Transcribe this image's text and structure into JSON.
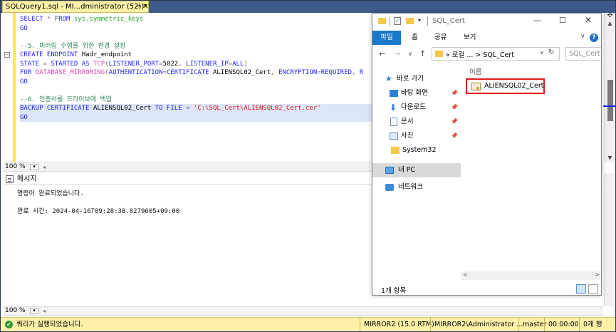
{
  "tab": {
    "title": "SQLQuery1.sql - MI...dministrator (52))*",
    "pin_glyph": "⊸",
    "close_glyph": "✕"
  },
  "code_lines": [
    {
      "segments": [
        {
          "c": "kw",
          "t": "SELECT "
        },
        {
          "c": "gray",
          "t": "* "
        },
        {
          "c": "kw",
          "t": "FROM "
        },
        {
          "c": "sys",
          "t": "sys.symmetric_keys"
        }
      ]
    },
    {
      "segments": [
        {
          "c": "kw",
          "t": "GO"
        }
      ]
    },
    {
      "segments": []
    },
    {
      "segments": [
        {
          "c": "cm",
          "t": "--5. 미러링 수행를 위한 환경 설정"
        }
      ]
    },
    {
      "segments": [
        {
          "c": "kw",
          "t": "CREATE ENDPOINT "
        },
        {
          "c": "plain",
          "t": "Hadr_endpoint"
        }
      ]
    },
    {
      "segments": [
        {
          "c": "kw",
          "t": "STATE "
        },
        {
          "c": "gray",
          "t": "= "
        },
        {
          "c": "kw",
          "t": "STARTED AS "
        },
        {
          "c": "fn",
          "t": "TCP"
        },
        {
          "c": "gray",
          "t": "("
        },
        {
          "c": "kw",
          "t": "LISTENER_PORT"
        },
        {
          "c": "gray",
          "t": "="
        },
        {
          "c": "plain",
          "t": "5022"
        },
        {
          "c": "gray",
          "t": ", "
        },
        {
          "c": "kw",
          "t": "LISTENER_IP"
        },
        {
          "c": "gray",
          "t": "="
        },
        {
          "c": "kw",
          "t": "ALL"
        },
        {
          "c": "gray",
          "t": ")"
        }
      ]
    },
    {
      "segments": [
        {
          "c": "kw",
          "t": "FOR "
        },
        {
          "c": "fn",
          "t": "DATABASE_MIRRORING"
        },
        {
          "c": "gray",
          "t": "("
        },
        {
          "c": "kw",
          "t": "AUTHENTICATION"
        },
        {
          "c": "gray",
          "t": "="
        },
        {
          "c": "kw",
          "t": "CERTIFICATE "
        },
        {
          "c": "plain",
          "t": "ALIENSQL02_Cert"
        },
        {
          "c": "gray",
          "t": ", "
        },
        {
          "c": "kw",
          "t": "ENCRYPTION"
        },
        {
          "c": "gray",
          "t": "="
        },
        {
          "c": "kw",
          "t": "REQUIRED"
        },
        {
          "c": "gray",
          "t": ", "
        },
        {
          "c": "kw",
          "t": "R"
        }
      ]
    },
    {
      "segments": [
        {
          "c": "kw",
          "t": "GO"
        }
      ]
    },
    {
      "segments": []
    },
    {
      "segments": [
        {
          "c": "cm",
          "t": "--6. 인증서를 드라이브에 백업"
        }
      ]
    },
    {
      "segments": [
        {
          "c": "kw",
          "t": "BACKUP CERTIFICATE "
        },
        {
          "c": "plain",
          "t": "ALIENSQL02_Cert "
        },
        {
          "c": "kw",
          "t": "TO FILE "
        },
        {
          "c": "gray",
          "t": "= "
        },
        {
          "c": "str",
          "t": "'C:\\SQL_Cert\\ALIENSQL02_Cert.cer'"
        }
      ]
    },
    {
      "segments": [
        {
          "c": "kw",
          "t": "GO"
        }
      ]
    }
  ],
  "collapse_glyph": "−",
  "editor_zoom": "100 %",
  "results_zoom": "100 %",
  "dropdown_glyph": "▾",
  "hscroll_left_glyph": "◂",
  "messages_tab_label": "메시지",
  "messages": {
    "line1": "명령이 완료되었습니다.",
    "line2": "완료 시간: 2024-04-16T09:28:38.8279605+09:00"
  },
  "vscroll": {
    "split_glyph": "✣",
    "up_glyph": "▲",
    "down_glyph": "▼"
  },
  "explorer": {
    "title": "SQL_Cert",
    "title_arrow": "▾",
    "check_glyph": "✓",
    "minimize_glyph": "—",
    "maximize_glyph": "☐",
    "close_glyph": "✕",
    "ribbon": {
      "file": "파일",
      "home": "홈",
      "share": "공유",
      "view": "보기",
      "expand_glyph": "∨",
      "help_glyph": "?"
    },
    "nav_back": "←",
    "nav_forward": "→",
    "nav_recent": "∨",
    "nav_up": "↑",
    "address_path": "« 로컬 ...  >  SQL_Cert",
    "address_dropdown": "∨",
    "refresh_glyph": "↻",
    "search_placeholder": "SQL_Cert",
    "quick_access": "바로 가기",
    "pin_glyph": "📌",
    "nav_items": {
      "desktop": "바탕 화면",
      "downloads": "다운로드",
      "documents": "문서",
      "pictures": "사진",
      "system32": "System32",
      "this_pc": "내 PC",
      "network": "네트워크"
    },
    "column_header": "이름",
    "file_name": "ALIENSQL02_Cert",
    "scroll_left": "<",
    "scroll_right": ">",
    "item_count": "1개 항목"
  },
  "status": {
    "ok_glyph": "✔",
    "message": "쿼리가 실행되었습니다.",
    "server": "MIRROR2 (15.0 RTM)",
    "user": "MIRROR2\\Administrator ...",
    "database": "master",
    "elapsed": "00:00:00",
    "rows": "0개 행"
  }
}
